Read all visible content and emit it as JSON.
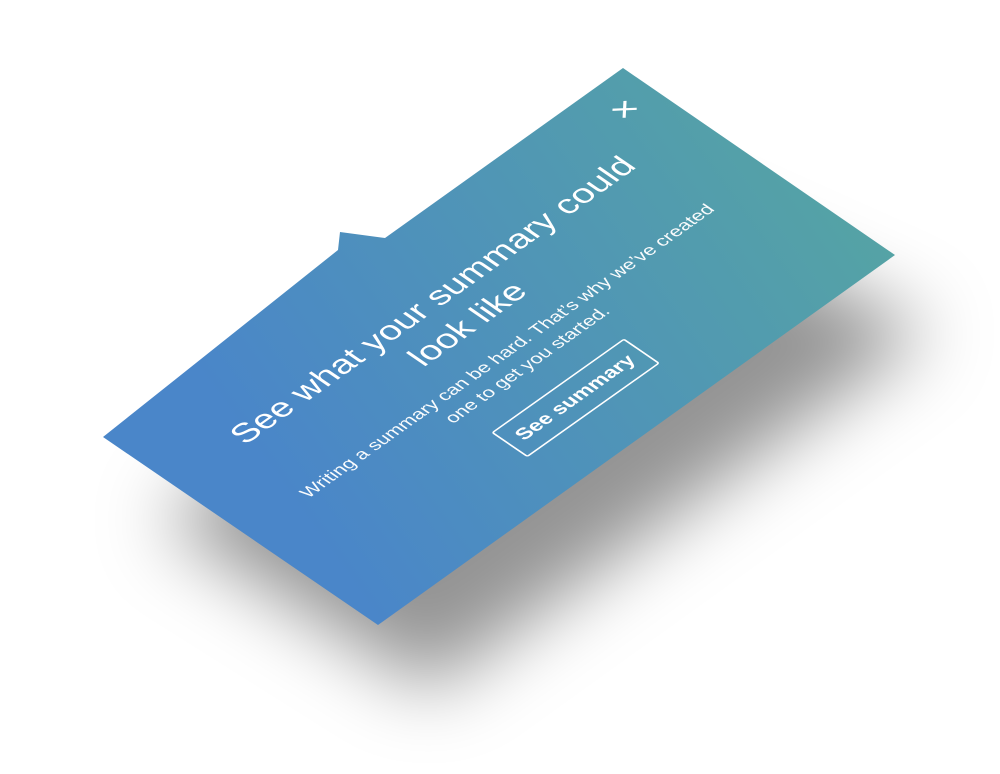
{
  "popover": {
    "title": "See what your summary could look like",
    "description": "Writing a summary can be hard. That’s why we’ve created one to get you started.",
    "cta_label": "See summary",
    "close_glyph": "×"
  },
  "colors": {
    "gradient_start": "#4a86c9",
    "gradient_end": "#55a3a5",
    "text": "#ffffff",
    "shadow": "#000000"
  },
  "icons": {
    "close": "close-icon"
  }
}
